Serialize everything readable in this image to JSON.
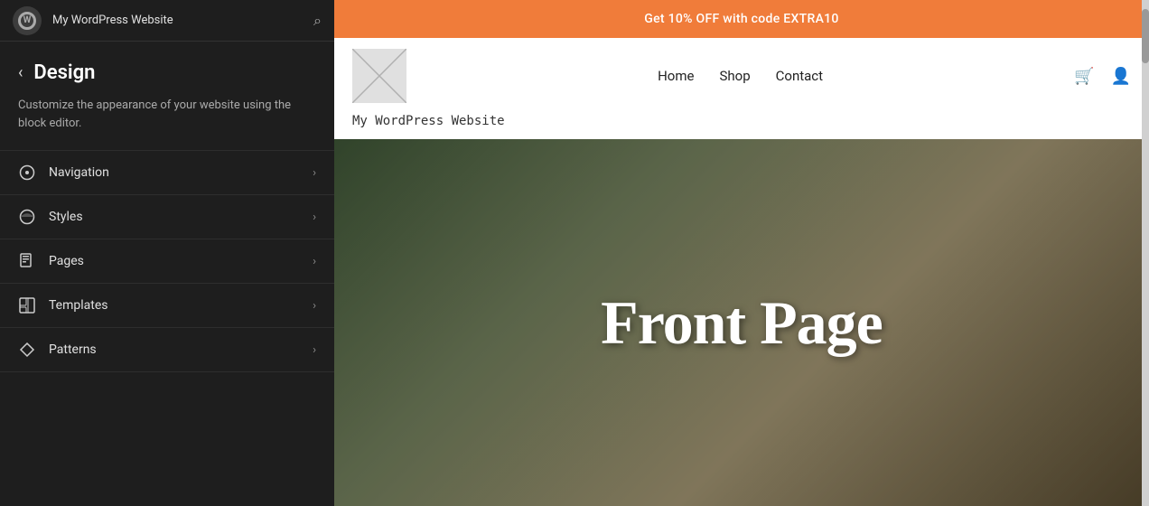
{
  "topbar": {
    "site_name": "My WordPress Website",
    "search_placeholder": "Search"
  },
  "sidebar": {
    "back_label": "←",
    "title": "Design",
    "description": "Customize the appearance of your website using the block editor.",
    "menu_items": [
      {
        "id": "navigation",
        "label": "Navigation",
        "icon": "navigation-icon"
      },
      {
        "id": "styles",
        "label": "Styles",
        "icon": "styles-icon"
      },
      {
        "id": "pages",
        "label": "Pages",
        "icon": "pages-icon"
      },
      {
        "id": "templates",
        "label": "Templates",
        "icon": "templates-icon"
      },
      {
        "id": "patterns",
        "label": "Patterns",
        "icon": "patterns-icon"
      }
    ]
  },
  "preview": {
    "promo_banner": "Get 10% OFF with code EXTRA10",
    "nav_links": [
      "Home",
      "Shop",
      "Contact"
    ],
    "site_tagline": "My WordPress Website",
    "hero_text": "Front Page"
  },
  "colors": {
    "promo_bg": "#f07c3a",
    "sidebar_bg": "#1e1e1e",
    "header_bg": "#ffffff"
  }
}
